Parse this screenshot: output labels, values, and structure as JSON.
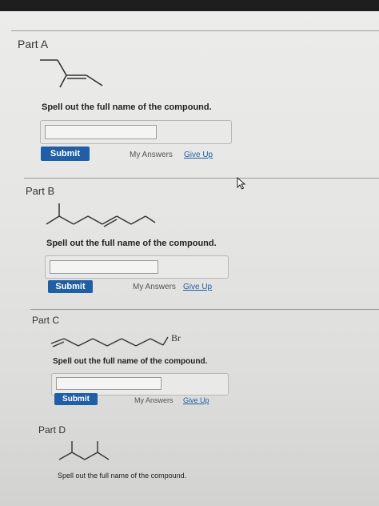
{
  "parts": [
    {
      "title": "Part A",
      "prompt": "Spell out the full name of the compound.",
      "submit": "Submit",
      "my_answers": "My Answers",
      "give_up": "Give Up",
      "answer": ""
    },
    {
      "title": "Part B",
      "prompt": "Spell out the full name of the compound.",
      "submit": "Submit",
      "my_answers": "My Answers",
      "give_up": "Give Up",
      "answer": ""
    },
    {
      "title": "Part C",
      "prompt": "Spell out the full name of the compound.",
      "submit": "Submit",
      "my_answers": "My Answers",
      "give_up": "Give Up",
      "answer": "",
      "substituent": "Br"
    },
    {
      "title": "Part D",
      "prompt": "Spell out the full name of the compound."
    }
  ]
}
